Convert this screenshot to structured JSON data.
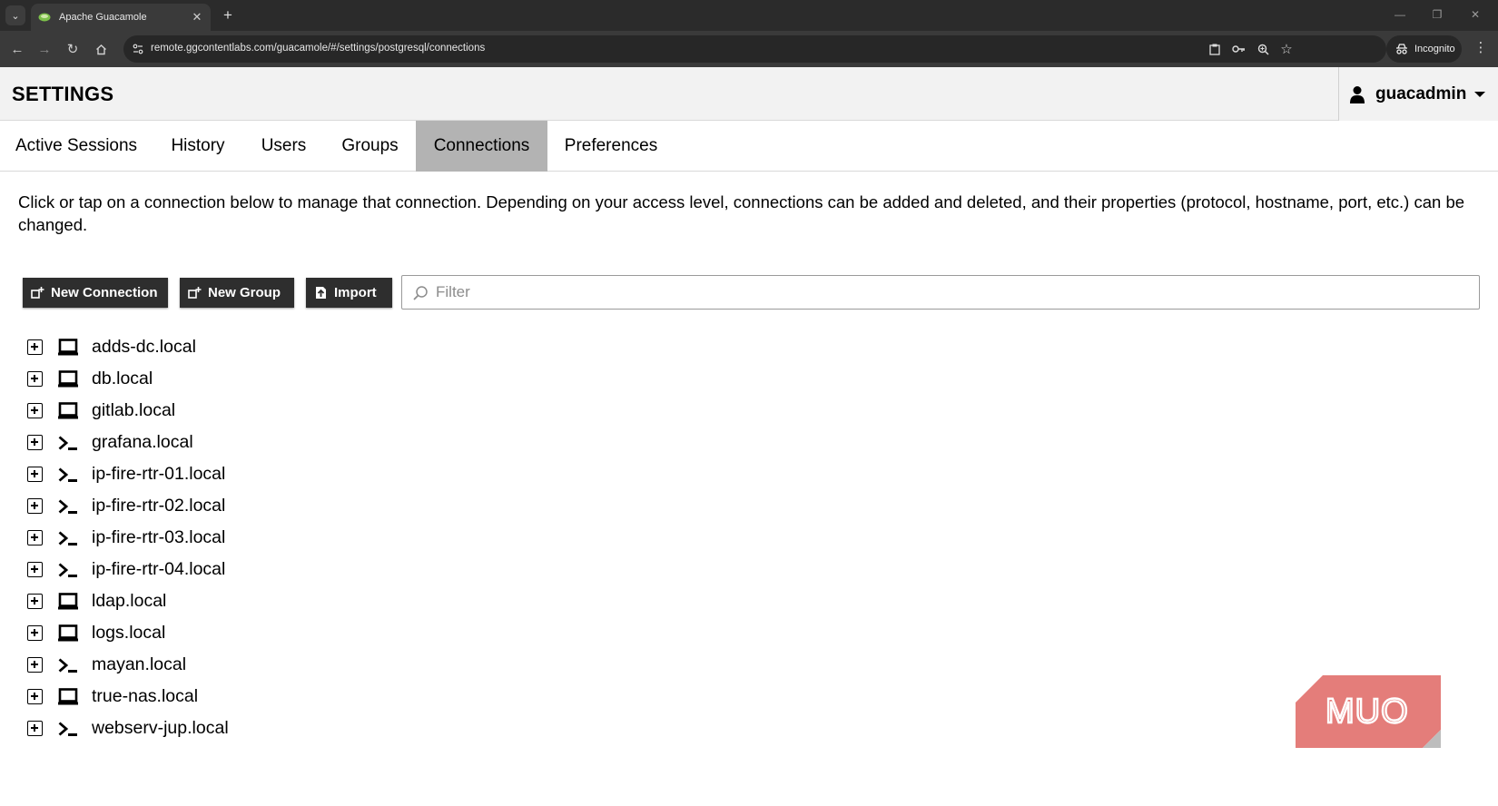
{
  "browser": {
    "tab_title": "Apache Guacamole",
    "url": "remote.ggcontentlabs.com/guacamole/#/settings/postgresql/connections",
    "incognito_label": "Incognito",
    "new_tab_symbol": "+",
    "close_symbol": "✕"
  },
  "header": {
    "title": "SETTINGS",
    "username": "guacadmin"
  },
  "tabs": [
    {
      "label": "Active Sessions",
      "active": false
    },
    {
      "label": "History",
      "active": false
    },
    {
      "label": "Users",
      "active": false
    },
    {
      "label": "Groups",
      "active": false
    },
    {
      "label": "Connections",
      "active": true
    },
    {
      "label": "Preferences",
      "active": false
    }
  ],
  "content": {
    "description": "Click or tap on a connection below to manage that connection. Depending on your access level, connections can be added and deleted, and their properties (protocol, hostname, port, etc.) can be changed.",
    "buttons": {
      "new_connection": "New Connection",
      "new_group": "New Group",
      "import": "Import"
    },
    "filter_placeholder": "Filter"
  },
  "connections": [
    {
      "name": "adds-dc.local",
      "icon": "monitor-icon"
    },
    {
      "name": "db.local",
      "icon": "monitor-icon"
    },
    {
      "name": "gitlab.local",
      "icon": "monitor-icon"
    },
    {
      "name": "grafana.local",
      "icon": "terminal-icon"
    },
    {
      "name": "ip-fire-rtr-01.local",
      "icon": "terminal-icon"
    },
    {
      "name": "ip-fire-rtr-02.local",
      "icon": "terminal-icon"
    },
    {
      "name": "ip-fire-rtr-03.local",
      "icon": "terminal-icon"
    },
    {
      "name": "ip-fire-rtr-04.local",
      "icon": "terminal-icon"
    },
    {
      "name": "ldap.local",
      "icon": "monitor-icon"
    },
    {
      "name": "logs.local",
      "icon": "monitor-icon"
    },
    {
      "name": "mayan.local",
      "icon": "terminal-icon"
    },
    {
      "name": "true-nas.local",
      "icon": "monitor-icon"
    },
    {
      "name": "webserv-jup.local",
      "icon": "terminal-icon"
    }
  ],
  "watermark": {
    "text": "MUO",
    "color": "#e47d7a"
  }
}
